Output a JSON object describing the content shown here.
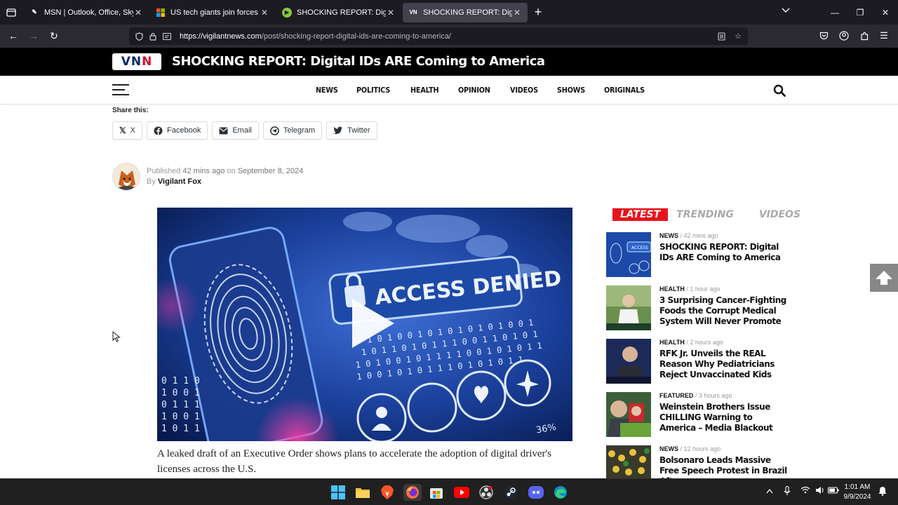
{
  "browser": {
    "tabs": [
      {
        "title": "MSN | Outlook, Office, Skype, B",
        "favicon": "msn-icon",
        "active": false
      },
      {
        "title": "US tech giants join forces to cre",
        "favicon": "microsoft-icon",
        "active": false
      },
      {
        "title": "SHOCKING REPORT: Digital IDs",
        "favicon": "rumble-icon",
        "active": false
      },
      {
        "title": "SHOCKING REPORT: Digital IDs",
        "favicon": "vnn-icon",
        "active": true
      }
    ],
    "url_host": "https://vigilantnews.com",
    "url_path": "/post/shocking-report-digital-ids-are-coming-to-america/"
  },
  "site": {
    "logo_text_a": "VN",
    "logo_text_b": "N",
    "headline": "SHOCKING REPORT: Digital IDs ARE Coming to America",
    "menu": [
      "NEWS",
      "POLITICS",
      "HEALTH",
      "OPINION",
      "VIDEOS",
      "SHOWS",
      "ORIGINALS"
    ]
  },
  "share": {
    "label": "Share this:",
    "buttons": [
      {
        "label": "X",
        "icon": "x-icon"
      },
      {
        "label": "Facebook",
        "icon": "facebook-icon"
      },
      {
        "label": "Email",
        "icon": "email-icon"
      },
      {
        "label": "Telegram",
        "icon": "telegram-icon"
      },
      {
        "label": "Twitter",
        "icon": "twitter-icon"
      }
    ]
  },
  "author": {
    "published_prefix": "Published",
    "published_ago": "42 mins ago",
    "on": "on",
    "date": "September 8, 2024",
    "by": "By",
    "name": "Vigilant Fox"
  },
  "video": {
    "overlay_text": "ACCESS DENIED",
    "percent": "36%",
    "binary_lines": [
      "1 0 1 0 0 1 0 1 0 1 0 1 0 1 0 0 1",
      "1 0 1 1 0 1 0 1 1 1 0 0 1 1 0 1 0 1",
      "1 0 1 0 0 1 0 1 1 1 1 0 0 1 0 1 0 1 1",
      "1 0 0 1 0 1 0 1 1 1 0 1 0 1 0 1 1"
    ],
    "left_binary": [
      "0 1 1 0",
      "1 0 0 1",
      "0 1 1 1",
      "1 0 0 1",
      "1 0 1 1"
    ]
  },
  "article": {
    "caption": "A leaked draft of an Executive Order shows plans to accelerate the adoption of digital driver's licenses across the U.S."
  },
  "sidebar": {
    "tabs": [
      "LATEST",
      "TRENDING",
      "VIDEOS"
    ],
    "items": [
      {
        "category": "NEWS",
        "time": "42 mins ago",
        "headline": "SHOCKING REPORT: Digital IDs ARE Coming to America"
      },
      {
        "category": "HEALTH",
        "time": "1 hour ago",
        "headline": "3 Surprising Cancer-Fighting Foods the Corrupt Medical System Will Never Promote"
      },
      {
        "category": "HEALTH",
        "time": "2 hours ago",
        "headline": "RFK Jr. Unveils the REAL Reason Why Pediatricians Reject Unvaccinated Kids"
      },
      {
        "category": "FEATURED",
        "time": "3 hours ago",
        "headline": "Weinstein Brothers Issue CHILLING Warning to America – Media Blackout"
      },
      {
        "category": "NEWS",
        "time": "12 hours ago",
        "headline": "Bolsonaro Leads Massive Free Speech Protest in Brazil After"
      }
    ],
    "separator": "/"
  },
  "taskbar": {
    "time": "1:01 AM",
    "date": "9/9/2024"
  },
  "colors": {
    "accent_red": "#e8141c",
    "site_black": "#000000",
    "logo_blue": "#0b2a63"
  }
}
